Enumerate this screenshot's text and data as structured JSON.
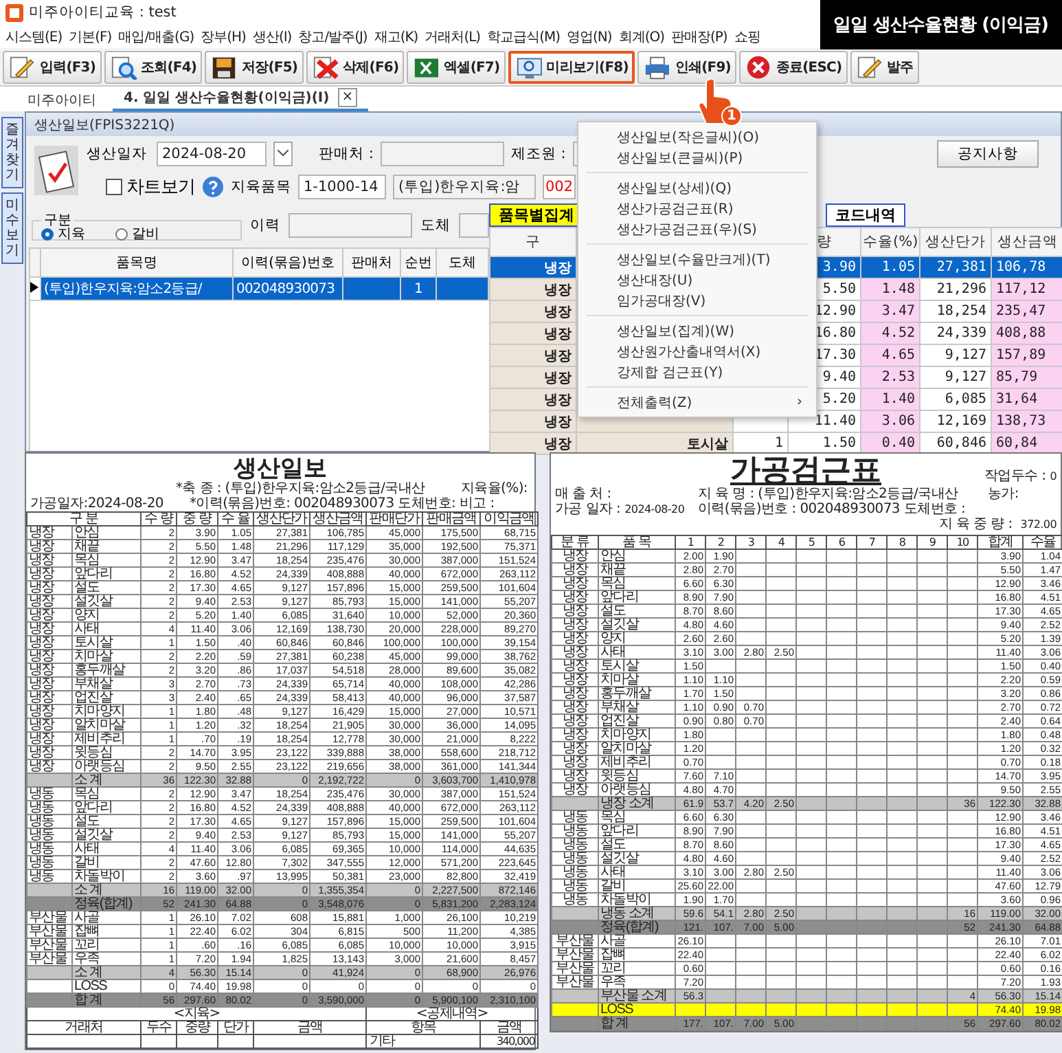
{
  "window": {
    "title": "미주아이티교육 : test"
  },
  "banner": "일일 생산수율현황 (이익금)",
  "menu_bar": [
    "시스템(E)",
    "기본(F)",
    "매입/매출(G)",
    "장부(H)",
    "생산(I)",
    "창고/발주(J)",
    "재고(K)",
    "거래처(L)",
    "학교급식(M)",
    "영업(N)",
    "회계(O)",
    "판매장(P)",
    "쇼핑"
  ],
  "toolbar": [
    {
      "kind": "input",
      "label": "입력(F3)",
      "highlighted": false
    },
    {
      "kind": "search",
      "label": "조회(F4)",
      "highlighted": false
    },
    {
      "kind": "save",
      "label": "저장(F5)",
      "highlighted": false
    },
    {
      "kind": "delete",
      "label": "삭제(F6)",
      "highlighted": false
    },
    {
      "kind": "excel",
      "label": "엑셀(F7)",
      "highlighted": false
    },
    {
      "kind": "preview",
      "label": "미리보기(F8)",
      "highlighted": true
    },
    {
      "kind": "print",
      "label": "인쇄(F9)",
      "highlighted": false
    },
    {
      "kind": "exit",
      "label": "종료(ESC)",
      "highlighted": false
    },
    {
      "kind": "input",
      "label": "발주",
      "highlighted": false
    }
  ],
  "tabs": [
    {
      "label": "미주아이티",
      "selected": false
    },
    {
      "label": "4. 일일 생산수율현황(이익금)(I)",
      "selected": true,
      "close": "×"
    }
  ],
  "side_tabs": [
    "즐겨찾기",
    "미수보기"
  ],
  "form": {
    "title": "생산일보(FPIS3221Q)",
    "date_label": "생산일자",
    "date": "2024-08-20",
    "seller_label": "판매처 :",
    "maker_label": "제조원 :",
    "notice_button": "공지사항",
    "chart_check": {
      "label": "차트보기",
      "checked": false
    },
    "item_label": "지육품목",
    "item_code": "1-1000-14",
    "item_name": "(투입)한우지육:암",
    "code_prefix": "002"
  },
  "filter": {
    "group_label": "구분",
    "options": [
      {
        "label": "지육",
        "selected": true
      },
      {
        "label": "갈비",
        "selected": false
      }
    ],
    "history_label": "이력",
    "carcass_label": "도체"
  },
  "grid": {
    "columns": [
      "품목명",
      "이력(묶음)번호",
      "판매처",
      "순번",
      "도체"
    ],
    "rows": [
      {
        "name": "(투입)한우지육:암소2등급/",
        "trace_no": "002048930073",
        "seq": "1",
        "selected": true
      }
    ]
  },
  "summary": {
    "tabs": [
      {
        "label": "품목별집계",
        "selected": true
      },
      {
        "label": "코드내역",
        "selected": false
      }
    ],
    "columns": [
      "구",
      "량",
      "수율(%)",
      "생산단가",
      "생산금액"
    ],
    "rows": [
      {
        "group": "냉장",
        "weight": "3.90",
        "yield": "1.05",
        "unit_cost": "27,381",
        "amount": "106,78",
        "selected": true
      },
      {
        "group": "냉장",
        "weight": "5.50",
        "yield": "1.48",
        "unit_cost": "21,296",
        "amount": "117,12",
        "selected": false
      },
      {
        "group": "냉장",
        "weight": "12.90",
        "yield": "3.47",
        "unit_cost": "18,254",
        "amount": "235,47",
        "selected": false
      },
      {
        "group": "냉장",
        "weight": "16.80",
        "yield": "4.52",
        "unit_cost": "24,339",
        "amount": "408,88",
        "selected": false
      },
      {
        "group": "냉장",
        "weight": "17.30",
        "yield": "4.65",
        "unit_cost": "9,127",
        "amount": "157,89",
        "selected": false
      },
      {
        "group": "냉장",
        "weight": "9.40",
        "yield": "2.53",
        "unit_cost": "9,127",
        "amount": "85,79",
        "selected": false
      },
      {
        "group": "냉장",
        "weight": "5.20",
        "yield": "1.40",
        "unit_cost": "6,085",
        "amount": "31,64",
        "selected": false
      },
      {
        "group": "냉장",
        "weight": "11.40",
        "yield": "3.06",
        "unit_cost": "12,169",
        "amount": "138,73",
        "selected": false
      },
      {
        "group": "냉장",
        "item": "토시살",
        "qty": "1",
        "weight": "1.50",
        "yield": "0.40",
        "unit_cost": "60,846",
        "amount": "60,84",
        "selected": false
      }
    ]
  },
  "popup_menu": [
    [
      {
        "label": "생산일보(작은글씨)(O)"
      },
      {
        "label": "생산일보(큰글씨)(P)"
      }
    ],
    [
      {
        "label": "생산일보(상세)(Q)"
      },
      {
        "label": "생산가공검근표(R)"
      },
      {
        "label": "생산가공검근표(우)(S)"
      }
    ],
    [
      {
        "label": "생산일보(수율만크게)(T)"
      },
      {
        "label": "생산대장(U)"
      },
      {
        "label": "임가공대장(V)"
      }
    ],
    [
      {
        "label": "생산일보(집계)(W)"
      },
      {
        "label": "생산원가산출내역서(X)"
      },
      {
        "label": "강제합 검근표(Y)"
      }
    ],
    [
      {
        "label": "전체출력(Z)",
        "arrow": "›"
      }
    ]
  ],
  "step_badge": "1",
  "daily_report": {
    "title": "생산일보",
    "species": "*축 종 : (투입)한우지육:암소2등급/국내산",
    "yield_label": "지육율(%):",
    "date": "가공일자:2024-08-20",
    "trace": "*이력(묶음)번호: 002048930073 도체번호: 비고 :",
    "columns": [
      "구 분",
      "수 량",
      "중 량",
      "수 율",
      "생산단가",
      "생산금액",
      "판매단가",
      "판매금액",
      "이익금액"
    ],
    "rows": [
      {
        "kind": "item",
        "group": "냉장",
        "item": "안심",
        "values": [
          "2",
          "3.90",
          "1.05",
          "27,381",
          "106,785",
          "45,000",
          "175,500",
          "68,715"
        ]
      },
      {
        "kind": "item",
        "group": "냉장",
        "item": "채끝",
        "values": [
          "2",
          "5.50",
          "1.48",
          "21,296",
          "117,129",
          "35,000",
          "192,500",
          "75,371"
        ]
      },
      {
        "kind": "item",
        "group": "냉장",
        "item": "목심",
        "values": [
          "2",
          "12.90",
          "3.47",
          "18,254",
          "235,476",
          "30,000",
          "387,000",
          "151,524"
        ]
      },
      {
        "kind": "item",
        "group": "냉장",
        "item": "앞다리",
        "values": [
          "2",
          "16.80",
          "4.52",
          "24,339",
          "408,888",
          "40,000",
          "672,000",
          "263,112"
        ]
      },
      {
        "kind": "item",
        "group": "냉장",
        "item": "설도",
        "values": [
          "2",
          "17.30",
          "4.65",
          "9,127",
          "157,896",
          "15,000",
          "259,500",
          "101,604"
        ]
      },
      {
        "kind": "item",
        "group": "냉장",
        "item": "설깃살",
        "values": [
          "2",
          "9.40",
          "2.53",
          "9,127",
          "85,793",
          "15,000",
          "141,000",
          "55,207"
        ]
      },
      {
        "kind": "item",
        "group": "냉장",
        "item": "양지",
        "values": [
          "2",
          "5.20",
          "1.40",
          "6,085",
          "31,640",
          "10,000",
          "52,000",
          "20,360"
        ]
      },
      {
        "kind": "item",
        "group": "냉장",
        "item": "사태",
        "values": [
          "4",
          "11.40",
          "3.06",
          "12,169",
          "138,730",
          "20,000",
          "228,000",
          "89,270"
        ]
      },
      {
        "kind": "item",
        "group": "냉장",
        "item": "토시살",
        "values": [
          "1",
          "1.50",
          ".40",
          "60,846",
          "60,846",
          "100,000",
          "100,000",
          "39,154"
        ]
      },
      {
        "kind": "item",
        "group": "냉장",
        "item": "치마살",
        "values": [
          "2",
          "2.20",
          ".59",
          "27,381",
          "60,238",
          "45,000",
          "99,000",
          "38,762"
        ]
      },
      {
        "kind": "item",
        "group": "냉장",
        "item": "홍두깨살",
        "values": [
          "2",
          "3.20",
          ".86",
          "17,037",
          "54,518",
          "28,000",
          "89,600",
          "35,082"
        ]
      },
      {
        "kind": "item",
        "group": "냉장",
        "item": "부채살",
        "values": [
          "3",
          "2.70",
          ".73",
          "24,339",
          "65,714",
          "40,000",
          "108,000",
          "42,286"
        ]
      },
      {
        "kind": "item",
        "group": "냉장",
        "item": "업진살",
        "values": [
          "3",
          "2.40",
          ".65",
          "24,339",
          "58,413",
          "40,000",
          "96,000",
          "37,587"
        ]
      },
      {
        "kind": "item",
        "group": "냉장",
        "item": "치마양지",
        "values": [
          "1",
          "1.80",
          ".48",
          "9,127",
          "16,429",
          "15,000",
          "27,000",
          "10,571"
        ]
      },
      {
        "kind": "item",
        "group": "냉장",
        "item": "알치마살",
        "values": [
          "1",
          "1.20",
          ".32",
          "18,254",
          "21,905",
          "30,000",
          "36,000",
          "14,095"
        ]
      },
      {
        "kind": "item",
        "group": "냉장",
        "item": "제비추리",
        "values": [
          "1",
          ".70",
          ".19",
          "18,254",
          "12,778",
          "30,000",
          "21,000",
          "8,222"
        ]
      },
      {
        "kind": "item",
        "group": "냉장",
        "item": "윗등심",
        "values": [
          "2",
          "14.70",
          "3.95",
          "23,122",
          "339,888",
          "38,000",
          "558,600",
          "218,712"
        ]
      },
      {
        "kind": "item",
        "group": "냉장",
        "item": "아랫등심",
        "values": [
          "2",
          "9.50",
          "2.55",
          "23,122",
          "219,656",
          "38,000",
          "361,000",
          "141,344"
        ]
      },
      {
        "kind": "subtotal",
        "item": "소 계",
        "values": [
          "36",
          "122.30",
          "32.88",
          "0",
          "2,192,722",
          "0",
          "3,603,700",
          "1,410,978"
        ]
      },
      {
        "kind": "item",
        "group": "냉동",
        "item": "목심",
        "values": [
          "2",
          "12.90",
          "3.47",
          "18,254",
          "235,476",
          "30,000",
          "387,000",
          "151,524"
        ]
      },
      {
        "kind": "item",
        "group": "냉동",
        "item": "앞다리",
        "values": [
          "2",
          "16.80",
          "4.52",
          "24,339",
          "408,888",
          "40,000",
          "672,000",
          "263,112"
        ]
      },
      {
        "kind": "item",
        "group": "냉동",
        "item": "설도",
        "values": [
          "2",
          "17.30",
          "4.65",
          "9,127",
          "157,896",
          "15,000",
          "259,500",
          "101,604"
        ]
      },
      {
        "kind": "item",
        "group": "냉동",
        "item": "설깃살",
        "values": [
          "2",
          "9.40",
          "2.53",
          "9,127",
          "85,793",
          "15,000",
          "141,000",
          "55,207"
        ]
      },
      {
        "kind": "item",
        "group": "냉동",
        "item": "사태",
        "values": [
          "4",
          "11.40",
          "3.06",
          "6,085",
          "69,365",
          "10,000",
          "114,000",
          "44,635"
        ]
      },
      {
        "kind": "item",
        "group": "냉동",
        "item": "갈비",
        "values": [
          "2",
          "47.60",
          "12.80",
          "7,302",
          "347,555",
          "12,000",
          "571,200",
          "223,645"
        ]
      },
      {
        "kind": "item",
        "group": "냉동",
        "item": "차돌박이",
        "values": [
          "2",
          "3.60",
          ".97",
          "13,995",
          "50,381",
          "23,000",
          "82,800",
          "32,419"
        ]
      },
      {
        "kind": "subtotal",
        "item": "소 계",
        "values": [
          "16",
          "119.00",
          "32.00",
          "0",
          "1,355,354",
          "0",
          "2,227,500",
          "872,146"
        ]
      },
      {
        "kind": "total",
        "item": "정육(합계)",
        "values": [
          "52",
          "241.30",
          "64.88",
          "0",
          "3,548,076",
          "0",
          "5,831,200",
          "2,283,124"
        ]
      },
      {
        "kind": "item",
        "group": "부산물",
        "item": "사골",
        "values": [
          "1",
          "26.10",
          "7.02",
          "608",
          "15,881",
          "1,000",
          "26,100",
          "10,219"
        ]
      },
      {
        "kind": "item",
        "group": "부산물",
        "item": "잡뼈",
        "values": [
          "1",
          "22.40",
          "6.02",
          "304",
          "6,815",
          "500",
          "11,200",
          "4,385"
        ]
      },
      {
        "kind": "item",
        "group": "부산물",
        "item": "꼬리",
        "values": [
          "1",
          ".60",
          ".16",
          "6,085",
          "6,085",
          "10,000",
          "10,000",
          "3,915"
        ]
      },
      {
        "kind": "item",
        "group": "부산물",
        "item": "우족",
        "values": [
          "1",
          "7.20",
          "1.94",
          "1,825",
          "13,143",
          "3,000",
          "21,600",
          "8,457"
        ]
      },
      {
        "kind": "subtotal",
        "item": "소 계",
        "values": [
          "4",
          "56.30",
          "15.14",
          "0",
          "41,924",
          "0",
          "68,900",
          "26,976"
        ]
      },
      {
        "kind": "loss",
        "item": "LOSS",
        "values": [
          "0",
          "74.40",
          "19.98",
          "0",
          "0",
          "0",
          "0",
          "0"
        ]
      },
      {
        "kind": "total",
        "item": "합 계",
        "values": [
          "56",
          "297.60",
          "80.02",
          "0",
          "3,590,000",
          "0",
          "5,900,100",
          "2,310,100"
        ]
      }
    ],
    "footer": {
      "sections": [
        "<지육>",
        "<공제내역>"
      ],
      "columns": [
        "거래처",
        "두수",
        "중량",
        "단가",
        "금액",
        "항목",
        "금액"
      ],
      "deduction_item": "기타",
      "deduction_amount": "340,000"
    }
  },
  "inspection_report": {
    "title": "가공검근표",
    "heads_label": "작업두수 :",
    "heads": "0",
    "buyer_label": "매 출 처 :",
    "carcass_name": "지 육 명 : (투입)한우지육:암소2등급/국내산",
    "farm_label": "농가:",
    "date_label": "가공 일자 :",
    "date": "2024-08-20",
    "trace": "이력(묶음)번호 : 002048930073 도체번호 :",
    "weight_label": "지 육 중 량 :",
    "weight": "372.00",
    "columns": [
      "분 류",
      "품 목",
      "1",
      "2",
      "3",
      "4",
      "5",
      "6",
      "7",
      "8",
      "9",
      "10",
      "합계",
      "수율"
    ],
    "rows": [
      {
        "kind": "item",
        "group": "냉장",
        "item": "안심",
        "cuts": [
          "2.00",
          "1.90"
        ],
        "sum": "3.90",
        "yield": "1.04"
      },
      {
        "kind": "item",
        "group": "냉장",
        "item": "채끝",
        "cuts": [
          "2.80",
          "2.70"
        ],
        "sum": "5.50",
        "yield": "1.47"
      },
      {
        "kind": "item",
        "group": "냉장",
        "item": "목심",
        "cuts": [
          "6.60",
          "6.30"
        ],
        "sum": "12.90",
        "yield": "3.46"
      },
      {
        "kind": "item",
        "group": "냉장",
        "item": "앞다리",
        "cuts": [
          "8.90",
          "7.90"
        ],
        "sum": "16.80",
        "yield": "4.51"
      },
      {
        "kind": "item",
        "group": "냉장",
        "item": "설도",
        "cuts": [
          "8.70",
          "8.60"
        ],
        "sum": "17.30",
        "yield": "4.65"
      },
      {
        "kind": "item",
        "group": "냉장",
        "item": "설깃살",
        "cuts": [
          "4.80",
          "4.60"
        ],
        "sum": "9.40",
        "yield": "2.52"
      },
      {
        "kind": "item",
        "group": "냉장",
        "item": "양지",
        "cuts": [
          "2.60",
          "2.60"
        ],
        "sum": "5.20",
        "yield": "1.39"
      },
      {
        "kind": "item",
        "group": "냉장",
        "item": "사태",
        "cuts": [
          "3.10",
          "3.00",
          "2.80",
          "2.50"
        ],
        "sum": "11.40",
        "yield": "3.06"
      },
      {
        "kind": "item",
        "group": "냉장",
        "item": "토시살",
        "cuts": [
          "1.50"
        ],
        "sum": "1.50",
        "yield": "0.40"
      },
      {
        "kind": "item",
        "group": "냉장",
        "item": "치마살",
        "cuts": [
          "1.10",
          "1.10"
        ],
        "sum": "2.20",
        "yield": "0.59"
      },
      {
        "kind": "item",
        "group": "냉장",
        "item": "홍두깨살",
        "cuts": [
          "1.70",
          "1.50"
        ],
        "sum": "3.20",
        "yield": "0.86"
      },
      {
        "kind": "item",
        "group": "냉장",
        "item": "부채살",
        "cuts": [
          "1.10",
          "0.90",
          "0.70"
        ],
        "sum": "2.70",
        "yield": "0.72"
      },
      {
        "kind": "item",
        "group": "냉장",
        "item": "업진살",
        "cuts": [
          "0.90",
          "0.80",
          "0.70"
        ],
        "sum": "2.40",
        "yield": "0.64"
      },
      {
        "kind": "item",
        "group": "냉장",
        "item": "치마양지",
        "cuts": [
          "1.80"
        ],
        "sum": "1.80",
        "yield": "0.48"
      },
      {
        "kind": "item",
        "group": "냉장",
        "item": "알치마살",
        "cuts": [
          "1.20"
        ],
        "sum": "1.20",
        "yield": "0.32"
      },
      {
        "kind": "item",
        "group": "냉장",
        "item": "제비추리",
        "cuts": [
          "0.70"
        ],
        "sum": "0.70",
        "yield": "0.18"
      },
      {
        "kind": "item",
        "group": "냉장",
        "item": "윗등심",
        "cuts": [
          "7.60",
          "7.10"
        ],
        "sum": "14.70",
        "yield": "3.95"
      },
      {
        "kind": "item",
        "group": "냉장",
        "item": "아랫등심",
        "cuts": [
          "4.80",
          "4.70"
        ],
        "sum": "9.50",
        "yield": "2.55"
      },
      {
        "kind": "subtotal",
        "item": "냉장 소계",
        "cuts": [
          "61.9",
          "53.7",
          "4.20",
          "2.50"
        ],
        "heads": "36",
        "sum": "122.30",
        "yield": "32.88"
      },
      {
        "kind": "item",
        "group": "냉동",
        "item": "목심",
        "cuts": [
          "6.60",
          "6.30"
        ],
        "sum": "12.90",
        "yield": "3.46"
      },
      {
        "kind": "item",
        "group": "냉동",
        "item": "앞다리",
        "cuts": [
          "8.90",
          "7.90"
        ],
        "sum": "16.80",
        "yield": "4.51"
      },
      {
        "kind": "item",
        "group": "냉동",
        "item": "설도",
        "cuts": [
          "8.70",
          "8.60"
        ],
        "sum": "17.30",
        "yield": "4.65"
      },
      {
        "kind": "item",
        "group": "냉동",
        "item": "설깃살",
        "cuts": [
          "4.80",
          "4.60"
        ],
        "sum": "9.40",
        "yield": "2.52"
      },
      {
        "kind": "item",
        "group": "냉동",
        "item": "사태",
        "cuts": [
          "3.10",
          "3.00",
          "2.80",
          "2.50"
        ],
        "sum": "11.40",
        "yield": "3.06"
      },
      {
        "kind": "item",
        "group": "냉동",
        "item": "갈비",
        "cuts": [
          "25.60",
          "22.00"
        ],
        "sum": "47.60",
        "yield": "12.79"
      },
      {
        "kind": "item",
        "group": "냉동",
        "item": "차돌박이",
        "cuts": [
          "1.90",
          "1.70"
        ],
        "sum": "3.60",
        "yield": "0.96"
      },
      {
        "kind": "subtotal",
        "item": "냉동 소계",
        "cuts": [
          "59.6",
          "54.1",
          "2.80",
          "2.50"
        ],
        "heads": "16",
        "sum": "119.00",
        "yield": "32.00"
      },
      {
        "kind": "total",
        "item": "정육(합계)",
        "cuts": [
          "121.",
          "107.",
          "7.00",
          "5.00"
        ],
        "heads": "52",
        "sum": "241.30",
        "yield": "64.88"
      },
      {
        "kind": "item",
        "group": "부산물",
        "item": "사골",
        "cuts": [
          "26.10"
        ],
        "sum": "26.10",
        "yield": "7.01"
      },
      {
        "kind": "item",
        "group": "부산물",
        "item": "잡뼈",
        "cuts": [
          "22.40"
        ],
        "sum": "22.40",
        "yield": "6.02"
      },
      {
        "kind": "item",
        "group": "부산물",
        "item": "꼬리",
        "cuts": [
          "0.60"
        ],
        "sum": "0.60",
        "yield": "0.16"
      },
      {
        "kind": "item",
        "group": "부산물",
        "item": "우족",
        "cuts": [
          "7.20"
        ],
        "sum": "7.20",
        "yield": "1.93"
      },
      {
        "kind": "subtotal",
        "item": "부산물 소계",
        "cuts": [
          "56.3"
        ],
        "heads": "4",
        "sum": "56.30",
        "yield": "15.14"
      },
      {
        "kind": "loss",
        "item": "LOSS",
        "sum": "74.40",
        "yield": "19.98"
      },
      {
        "kind": "total",
        "item": "합 계",
        "cuts": [
          "177.",
          "107.",
          "7.00",
          "5.00"
        ],
        "heads": "56",
        "sum": "297.60",
        "yield": "80.02"
      }
    ]
  }
}
